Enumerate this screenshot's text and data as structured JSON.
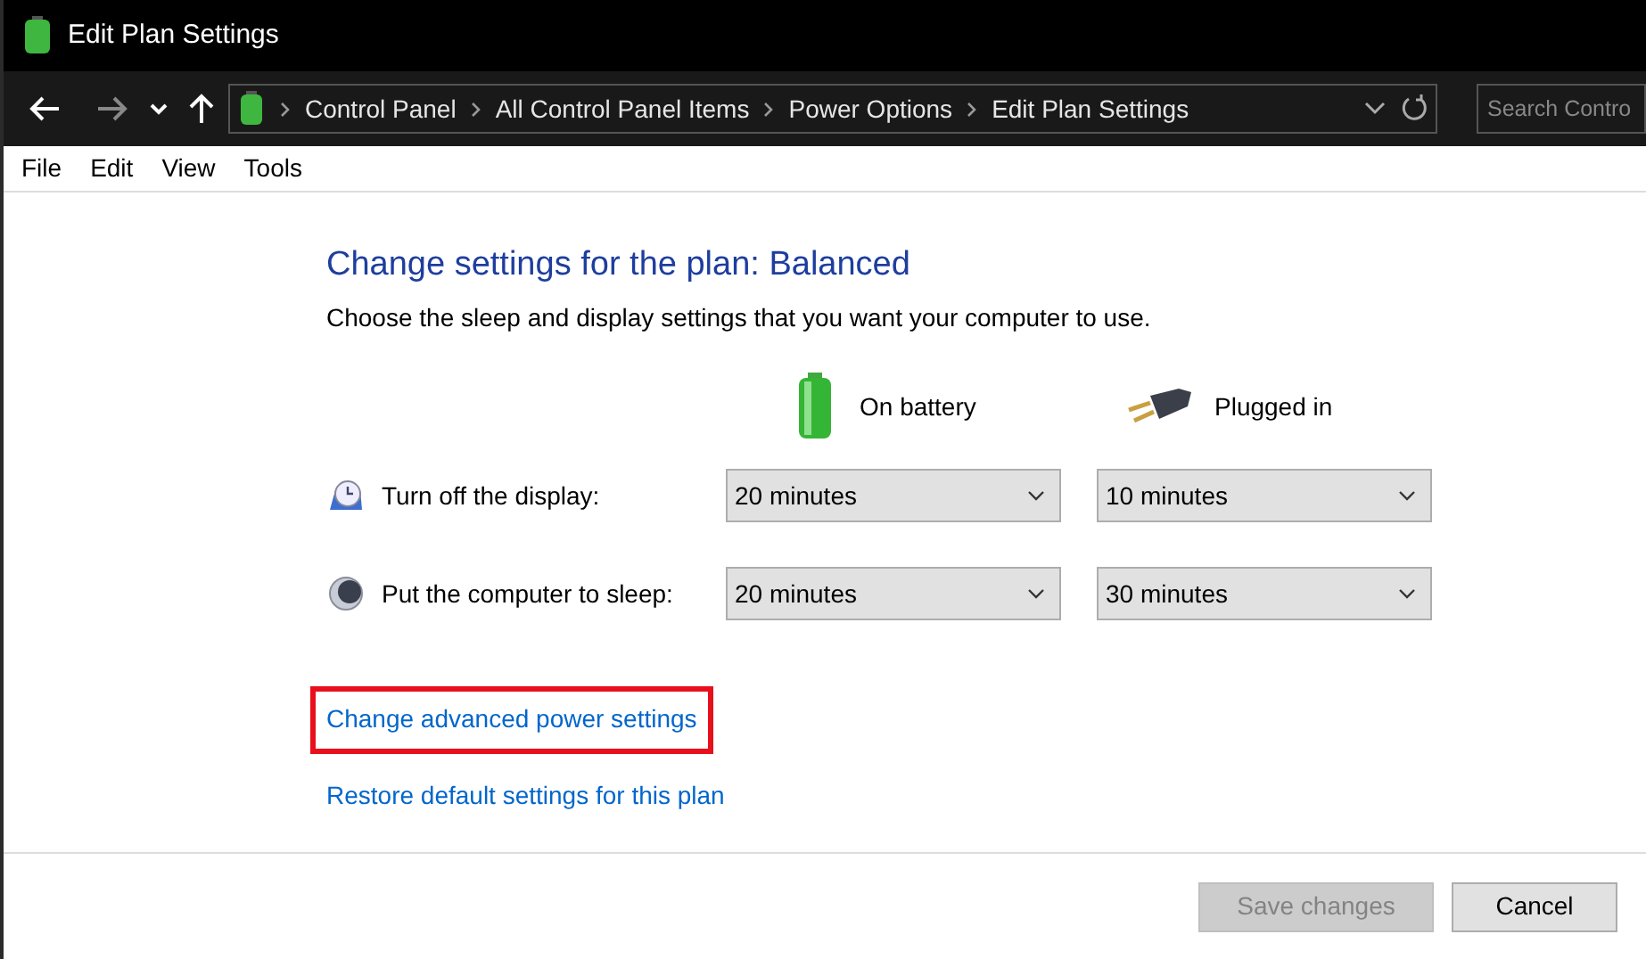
{
  "window": {
    "title": "Edit Plan Settings"
  },
  "breadcrumb": [
    "Control Panel",
    "All Control Panel Items",
    "Power Options",
    "Edit Plan Settings"
  ],
  "search": {
    "placeholder": "Search Contro"
  },
  "menu": [
    "File",
    "Edit",
    "View",
    "Tools"
  ],
  "heading": "Change settings for the plan: Balanced",
  "subheading": "Choose the sleep and display settings that you want your computer to use.",
  "columns": [
    {
      "kind": "battery",
      "label": "On battery"
    },
    {
      "kind": "plug",
      "label": "Plugged in"
    }
  ],
  "settings": [
    {
      "kind": "display",
      "label": "Turn off the display:",
      "values": [
        "20 minutes",
        "10 minutes"
      ]
    },
    {
      "kind": "sleep",
      "label": "Put the computer to sleep:",
      "values": [
        "20 minutes",
        "30 minutes"
      ]
    }
  ],
  "links": [
    {
      "label": "Change advanced power settings",
      "highlighted": true
    },
    {
      "label": "Restore default settings for this plan",
      "highlighted": false
    }
  ],
  "buttons": [
    {
      "label": "Save changes",
      "disabled": true
    },
    {
      "label": "Cancel",
      "disabled": false
    }
  ]
}
